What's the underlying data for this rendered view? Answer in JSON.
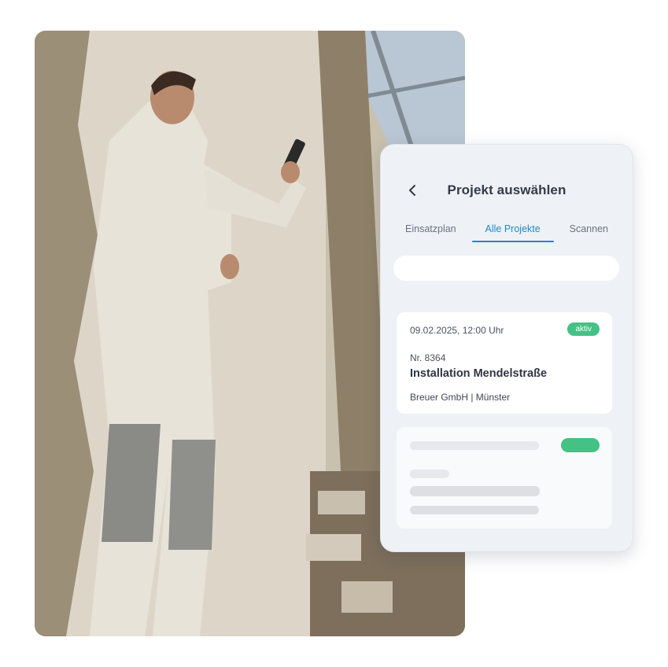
{
  "photo": {
    "subject": "worker-with-phone"
  },
  "screen": {
    "title": "Projekt auswählen",
    "back_icon": "chevron-left-icon",
    "tabs": [
      {
        "label": "Einsatzplan",
        "active": false
      },
      {
        "label": "Alle Projekte",
        "active": true
      },
      {
        "label": "Scannen",
        "active": false
      }
    ],
    "search": {
      "value": "",
      "placeholder": ""
    },
    "projects": [
      {
        "date": "09.02.2025, 12:00 Uhr",
        "status": "aktiv",
        "number": "Nr. 8364",
        "name": "Installation Mendelstraße",
        "company": "Breuer GmbH | Münster"
      }
    ]
  },
  "colors": {
    "accent": "#1f8ac9",
    "status_active": "#44c184",
    "panel_bg": "#eef1f6",
    "title_text": "#333a48"
  }
}
